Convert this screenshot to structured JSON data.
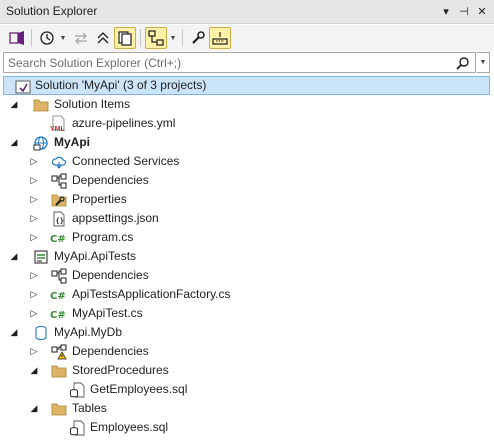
{
  "window": {
    "title": "Solution Explorer",
    "title_buttons": [
      "▾",
      "⊣",
      "✕"
    ]
  },
  "toolbar": {
    "items": [
      "vs-switch-views-icon",
      "history-icon",
      "sync-icon",
      "collapse-all-icon",
      "show-all-files-icon",
      "view-hierarchy-icon",
      "properties-wrench-icon",
      "preview-selected-icon"
    ]
  },
  "search": {
    "placeholder": "Search Solution Explorer (Ctrl+;)"
  },
  "tree": {
    "solution": "Solution 'MyApi' (3 of 3 projects)",
    "solution_items": {
      "label": "Solution Items",
      "children": [
        "azure-pipelines.yml"
      ]
    },
    "myapi": {
      "label": "MyApi",
      "children": [
        "Connected Services",
        "Dependencies",
        "Properties",
        "appsettings.json",
        "Program.cs"
      ]
    },
    "apitests": {
      "label": "MyApi.ApiTests",
      "children": [
        "Dependencies",
        "ApiTestsApplicationFactory.cs",
        "MyApiTest.cs"
      ]
    },
    "mydb": {
      "label": "MyApi.MyDb",
      "children": [
        "Dependencies",
        "StoredProcedures",
        "GetEmployees.sql",
        "Tables",
        "Employees.sql"
      ]
    }
  },
  "colors": {
    "selection": "#cce4f7",
    "folder": "#dcb367",
    "csharp": "#388a34",
    "yaml_red": "#c5322e"
  }
}
